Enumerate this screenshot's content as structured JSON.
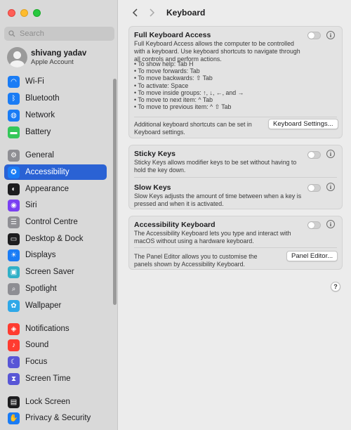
{
  "search": {
    "placeholder": "Search"
  },
  "account": {
    "name": "shivang yadav",
    "subtitle": "Apple Account"
  },
  "sidebar": {
    "items": [
      {
        "label": "Wi-Fi",
        "icon": "wifi-icon",
        "color": "#1a7cf5",
        "glyph": "◠"
      },
      {
        "label": "Bluetooth",
        "icon": "bluetooth-icon",
        "color": "#1a7cf5",
        "glyph": "ᛒ"
      },
      {
        "label": "Network",
        "icon": "network-icon",
        "color": "#1a7cf5",
        "glyph": "◍"
      },
      {
        "label": "Battery",
        "icon": "battery-icon",
        "color": "#34c759",
        "glyph": "▬"
      },
      {
        "label": "General",
        "icon": "gear-icon",
        "color": "#8e8e93",
        "glyph": "⚙"
      },
      {
        "label": "Accessibility",
        "icon": "accessibility-icon",
        "color": "#1a7cf5",
        "glyph": "✪"
      },
      {
        "label": "Appearance",
        "icon": "appearance-icon",
        "color": "#1d1d1f",
        "glyph": "◐"
      },
      {
        "label": "Siri",
        "icon": "siri-icon",
        "color": "#7a3ff2",
        "glyph": "◉"
      },
      {
        "label": "Control Centre",
        "icon": "control-centre-icon",
        "color": "#8e8e93",
        "glyph": "☰"
      },
      {
        "label": "Desktop & Dock",
        "icon": "desktop-dock-icon",
        "color": "#1d1d1f",
        "glyph": "▭"
      },
      {
        "label": "Displays",
        "icon": "displays-icon",
        "color": "#1a7cf5",
        "glyph": "☀"
      },
      {
        "label": "Screen Saver",
        "icon": "screen-saver-icon",
        "color": "#30b0c7",
        "glyph": "▣"
      },
      {
        "label": "Spotlight",
        "icon": "spotlight-icon",
        "color": "#8e8e93",
        "glyph": "⌕"
      },
      {
        "label": "Wallpaper",
        "icon": "wallpaper-icon",
        "color": "#2fa8e8",
        "glyph": "✿"
      },
      {
        "label": "Notifications",
        "icon": "notifications-icon",
        "color": "#ff3b30",
        "glyph": "◈"
      },
      {
        "label": "Sound",
        "icon": "sound-icon",
        "color": "#ff3b30",
        "glyph": "♪"
      },
      {
        "label": "Focus",
        "icon": "focus-icon",
        "color": "#5856d6",
        "glyph": "☾"
      },
      {
        "label": "Screen Time",
        "icon": "screen-time-icon",
        "color": "#5856d6",
        "glyph": "⧗"
      },
      {
        "label": "Lock Screen",
        "icon": "lock-screen-icon",
        "color": "#1d1d1f",
        "glyph": "▤"
      },
      {
        "label": "Privacy & Security",
        "icon": "privacy-icon",
        "color": "#1a7cf5",
        "glyph": "✋"
      }
    ],
    "active": "Accessibility"
  },
  "header": {
    "title": "Keyboard"
  },
  "full_keyboard_access": {
    "title": "Full Keyboard Access",
    "desc": "Full Keyboard Access allows the computer to be controlled with a keyboard. Use keyboard shortcuts to navigate through all controls and perform actions.",
    "shortcuts": [
      "• To show help: Tab H",
      "• To move forwards: Tab",
      "• To move backwards: ⇧ Tab",
      "• To activate: Space",
      "• To move inside groups: ↑, ↓, ←, and →",
      "• To move to next item: ^ Tab",
      "• To move to previous item: ^ ⇧ Tab"
    ],
    "toggle_on": false,
    "footer": "Additional keyboard shortcuts can be set in Keyboard settings.",
    "button": "Keyboard Settings..."
  },
  "sticky_keys": {
    "title": "Sticky Keys",
    "desc": "Sticky Keys allows modifier keys to be set without having to hold the key down.",
    "toggle_on": false
  },
  "slow_keys": {
    "title": "Slow Keys",
    "desc": "Slow Keys adjusts the amount of time between when a key is pressed and when it is activated.",
    "toggle_on": false
  },
  "accessibility_keyboard": {
    "title": "Accessibility Keyboard",
    "desc": "The Accessibility Keyboard lets you type and interact with macOS without using a hardware keyboard.",
    "toggle_on": false,
    "footer": "The Panel Editor allows you to customise the panels shown by Accessibility Keyboard.",
    "button": "Panel Editor..."
  },
  "help": {
    "label": "?"
  }
}
